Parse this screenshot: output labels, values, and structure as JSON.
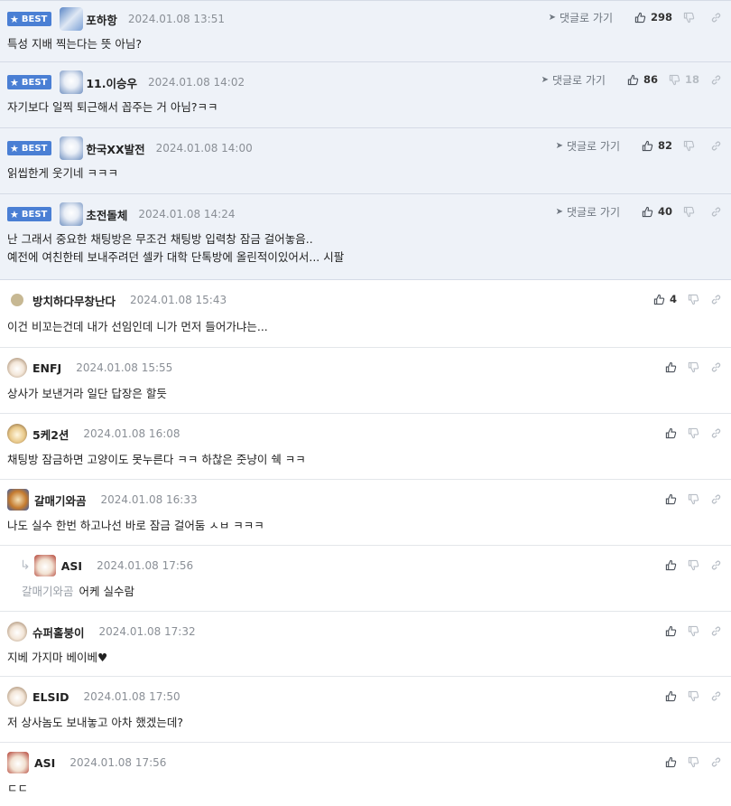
{
  "best_label": "BEST",
  "reply_link_label": "댓글로 가기",
  "comments": [
    {
      "nick": "포하항",
      "date": "2024.01.08 13:51",
      "text": [
        "특성 지배 찍는다는 뜻 아님?"
      ],
      "likes": "298",
      "dislikes": ""
    },
    {
      "nick": "11.이승우",
      "date": "2024.01.08 14:02",
      "text": [
        "자기보다 일찍 퇴근해서 꼽주는 거 아님?ㅋㅋ"
      ],
      "likes": "86",
      "dislikes": "18"
    },
    {
      "nick": "한국XX발전",
      "date": "2024.01.08 14:00",
      "text": [
        "읽씹한게 웃기네 ㅋㅋㅋ"
      ],
      "likes": "82",
      "dislikes": ""
    },
    {
      "nick": "초전돌체",
      "date": "2024.01.08 14:24",
      "text": [
        "난 그래서 중요한 채팅방은 무조건 채팅방 입력창 잠금 걸어놓음..",
        "예전에 여친한테 보내주려던 셀카 대학 단톡방에 올린적이있어서... 시팔"
      ],
      "likes": "40",
      "dislikes": ""
    },
    {
      "nick": "방치하다무창난다",
      "date": "2024.01.08 15:43",
      "text": [
        "이건 비꼬는건데 내가 선임인데 니가 먼저 들어가냐는..."
      ],
      "likes": "4",
      "dislikes": ""
    },
    {
      "nick": "ENFJ",
      "date": "2024.01.08 15:55",
      "text": [
        "상사가 보낸거라 일단 답장은 할듯"
      ],
      "likes": "",
      "dislikes": ""
    },
    {
      "nick": "5케2션",
      "date": "2024.01.08 16:08",
      "text": [
        "채팅방 잠금하면 고양이도 못누른다 ㅋㅋ 하찮은 줏냥이 쉑 ㅋㅋ"
      ],
      "likes": "",
      "dislikes": ""
    },
    {
      "nick": "갈매기와곰",
      "date": "2024.01.08 16:33",
      "text": [
        "나도 실수 한번 하고나선 바로 잠금 걸어둠 ㅅㅂ ㅋㅋㅋ"
      ],
      "likes": "",
      "dislikes": ""
    },
    {
      "nick": "ASI",
      "date": "2024.01.08 17:56",
      "mention": "갈매기와곰",
      "text": [
        "어케 실수람"
      ],
      "likes": "",
      "dislikes": ""
    },
    {
      "nick": "슈퍼홀붕이",
      "date": "2024.01.08 17:32",
      "text": [
        "지베 가지마 베이베♥"
      ],
      "likes": "",
      "dislikes": ""
    },
    {
      "nick": "ELSID",
      "date": "2024.01.08 17:50",
      "text": [
        "저 상사놈도 보내놓고 아차 했겠는데?"
      ],
      "likes": "",
      "dislikes": ""
    },
    {
      "nick": "ASI",
      "date": "2024.01.08 17:56",
      "text": [
        "ㄷㄷ"
      ],
      "likes": "",
      "dislikes": ""
    }
  ]
}
